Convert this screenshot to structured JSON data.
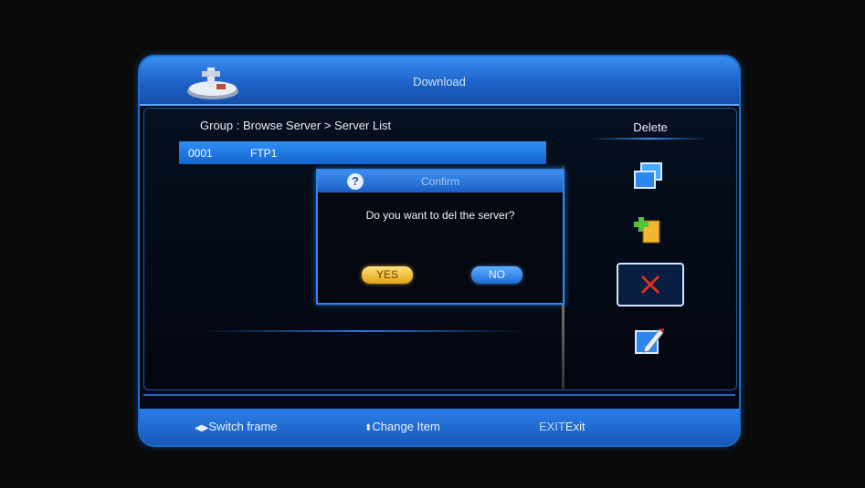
{
  "window": {
    "title": "Download"
  },
  "browser": {
    "breadcrumb": "Group : Browse Server > Server List",
    "rows": [
      {
        "num": "0001",
        "name": "FTP1"
      }
    ]
  },
  "sidebar": {
    "title": "Delete",
    "icons": [
      "windows-icon",
      "add-file-icon",
      "delete-x-icon",
      "edit-pencil-icon"
    ],
    "selected": "delete-x-icon"
  },
  "dialog": {
    "title": "Confirm",
    "message": "Do you want to del the server?",
    "yes_label": "YES",
    "no_label": "NO"
  },
  "footer": {
    "switch_frame": "Switch frame",
    "change_item": "Change Item",
    "exit_key": "EXIT",
    "exit_label": "Exit"
  },
  "colors": {
    "accent": "#1e63c9",
    "highlight": "#2f8ef5",
    "yes": "#e2a417",
    "delete": "#e03020"
  }
}
